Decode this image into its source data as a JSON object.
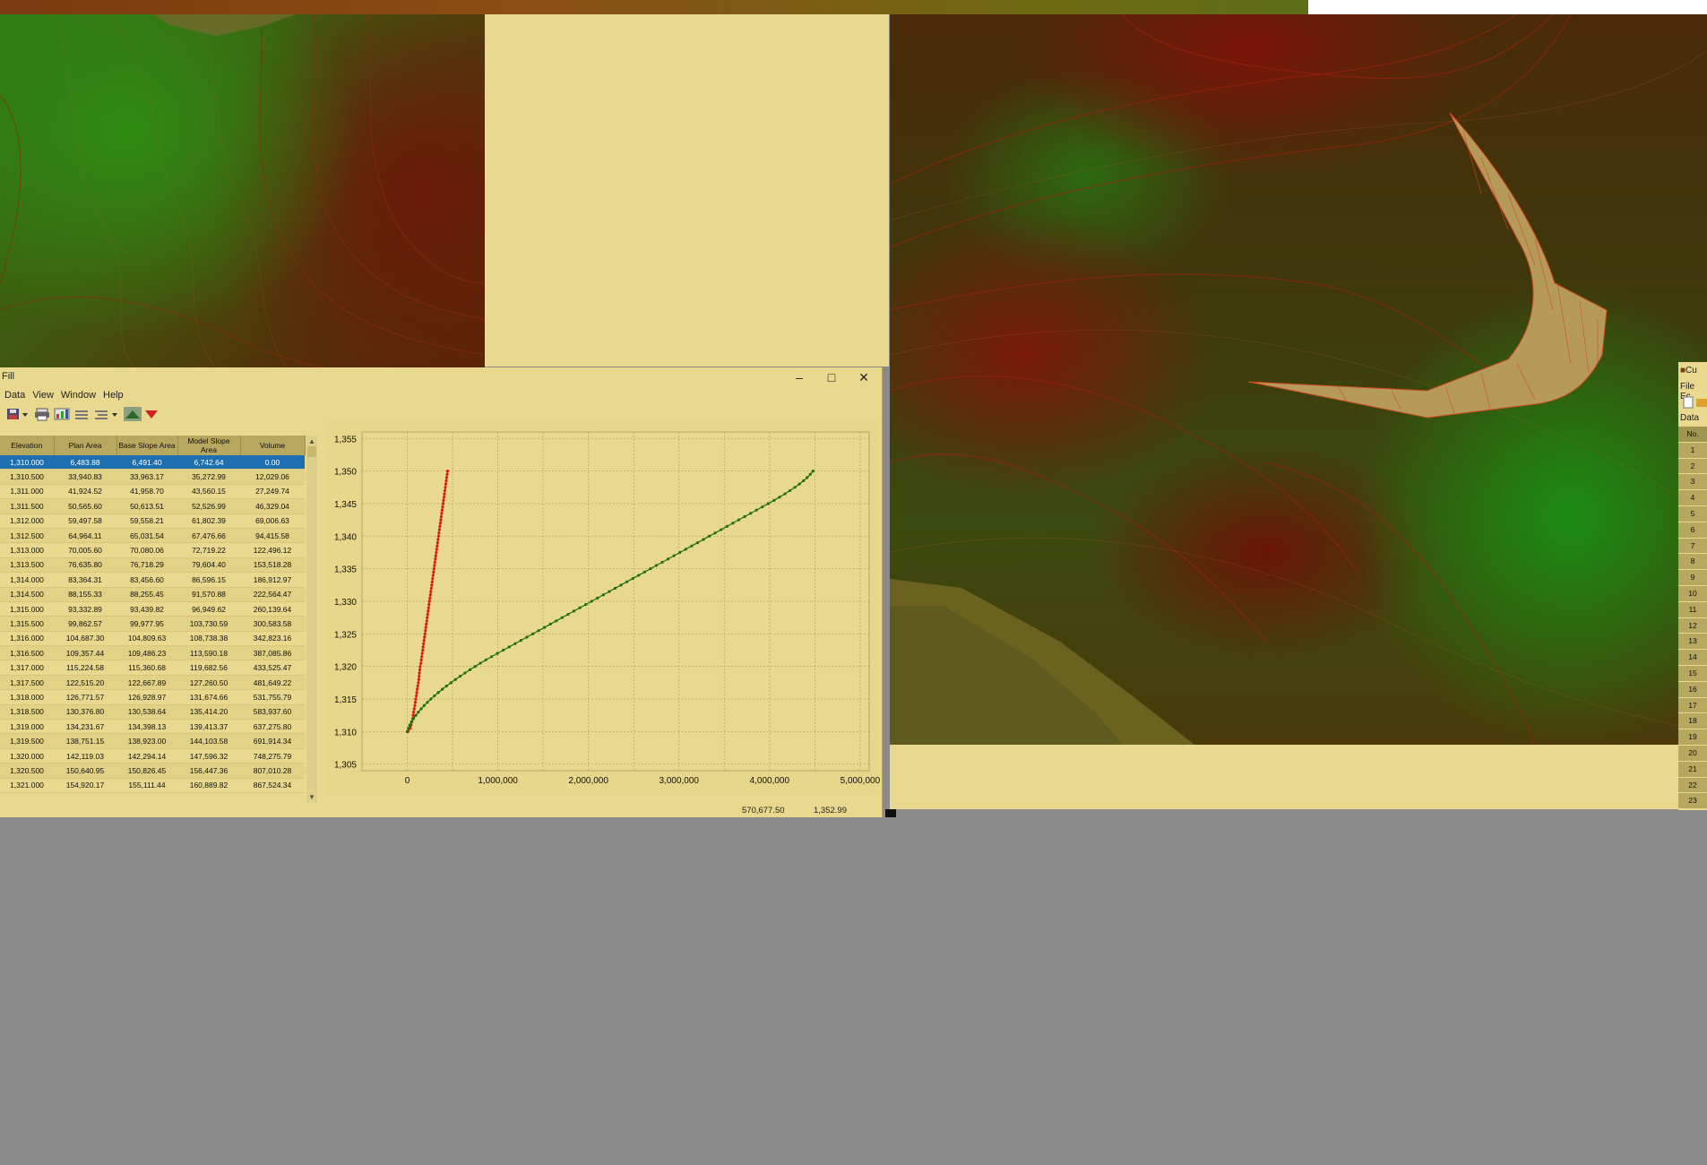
{
  "fill_window": {
    "title": "Fill",
    "menus": [
      "Data",
      "View",
      "Window",
      "Help"
    ],
    "window_buttons": {
      "minimize": "–",
      "maximize": "□",
      "close": "✕"
    },
    "table": {
      "columns": [
        "Elevation",
        "Plan Area",
        "Base Slope Area",
        "Model Slope Area",
        "Volume"
      ],
      "rows": [
        [
          "1,310.000",
          "6,483.88",
          "6,491.40",
          "6,742.64",
          "0.00"
        ],
        [
          "1,310.500",
          "33,940.83",
          "33,963.17",
          "35,272.99",
          "12,029.06"
        ],
        [
          "1,311.000",
          "41,924.52",
          "41,958.70",
          "43,560.15",
          "27,249.74"
        ],
        [
          "1,311.500",
          "50,565.60",
          "50,613.51",
          "52,526.99",
          "46,329.04"
        ],
        [
          "1,312.000",
          "59,497.58",
          "59,558.21",
          "61,802.39",
          "69,006.63"
        ],
        [
          "1,312.500",
          "64,964.11",
          "65,031.54",
          "67,476.66",
          "94,415.58"
        ],
        [
          "1,313.000",
          "70,005.60",
          "70,080.06",
          "72,719.22",
          "122,496.12"
        ],
        [
          "1,313.500",
          "76,635.80",
          "76,718.29",
          "79,604.40",
          "153,518.28"
        ],
        [
          "1,314.000",
          "83,364.31",
          "83,456.60",
          "86,596.15",
          "186,912.97"
        ],
        [
          "1,314.500",
          "88,155.33",
          "88,255.45",
          "91,570.88",
          "222,564.47"
        ],
        [
          "1,315.000",
          "93,332.89",
          "93,439.82",
          "96,949.62",
          "260,139.64"
        ],
        [
          "1,315.500",
          "99,862.57",
          "99,977.95",
          "103,730.59",
          "300,583.58"
        ],
        [
          "1,316.000",
          "104,687.30",
          "104,809.63",
          "108,738.38",
          "342,823.16"
        ],
        [
          "1,316.500",
          "109,357.44",
          "109,486.23",
          "113,590.18",
          "387,085.86"
        ],
        [
          "1,317.000",
          "115,224.58",
          "115,360.68",
          "119,682.56",
          "433,525.47"
        ],
        [
          "1,317.500",
          "122,515.20",
          "122,667.89",
          "127,260.50",
          "481,649.22"
        ],
        [
          "1,318.000",
          "126,771.57",
          "126,928.97",
          "131,674.66",
          "531,755.79"
        ],
        [
          "1,318.500",
          "130,376.80",
          "130,538.64",
          "135,414.20",
          "583,937.60"
        ],
        [
          "1,319.000",
          "134,231.67",
          "134,398.13",
          "139,413.37",
          "637,275.80"
        ],
        [
          "1,319.500",
          "138,751.15",
          "138,923.00",
          "144,103.58",
          "691,914.34"
        ],
        [
          "1,320.000",
          "142,119.03",
          "142,294.14",
          "147,596.32",
          "748,275.79"
        ],
        [
          "1,320.500",
          "150,640.95",
          "150,826.45",
          "156,447.36",
          "807,010.28"
        ],
        [
          "1,321.000",
          "154,920.17",
          "155,111.44",
          "160,889.82",
          "867,524.34"
        ]
      ]
    },
    "status": {
      "x_value": "570,677.50",
      "y_value": "1,352.99"
    }
  },
  "cu_window": {
    "title": "Cu",
    "menus": [
      "File",
      "Ec"
    ],
    "tab": "Data",
    "column": "No.",
    "rows": [
      "1",
      "2",
      "3",
      "4",
      "5",
      "6",
      "7",
      "8",
      "9",
      "10",
      "11",
      "12",
      "13",
      "14",
      "15",
      "16",
      "17",
      "18",
      "19",
      "20",
      "21",
      "22",
      "23"
    ]
  },
  "colors": {
    "panel": "#e8d98e",
    "header": "#b7a860",
    "selection": "#1e6fb0",
    "area_series": "#d81d0a",
    "volume_series": "#1e6e12"
  },
  "icons": [
    "save-icon",
    "print-icon",
    "chart-icon",
    "remove-row-icon",
    "insert-row-icon",
    "fill-icon",
    "cut-icon"
  ],
  "chart_data": {
    "type": "scatter",
    "x_ticks": [
      "0",
      "1,000,000",
      "2,000,000",
      "3,000,000",
      "4,000,000",
      "5,000,000"
    ],
    "y_ticks": [
      "1,305",
      "1,310",
      "1,315",
      "1,320",
      "1,325",
      "1,330",
      "1,335",
      "1,340",
      "1,345",
      "1,350",
      "1,355"
    ],
    "xlim": [
      -500000,
      5100000
    ],
    "ylim": [
      1304,
      1356
    ],
    "grid": true,
    "series": [
      {
        "color": "#d81d0a",
        "x": [
          6484,
          33941,
          41925,
          50566,
          59498,
          64964,
          70006,
          76636,
          83364,
          88155,
          93333,
          99863,
          104687,
          109357,
          115225,
          122515,
          126772,
          130377,
          134232,
          138751,
          142119,
          150641,
          154920,
          160000,
          165000,
          170000,
          175000,
          180000,
          185000,
          190000,
          195000,
          200000,
          205000,
          210000,
          215000,
          220000,
          225000,
          230000,
          235000,
          240000,
          245000,
          250000,
          255000,
          260000,
          265000,
          270000,
          275000,
          280000,
          285000,
          290000,
          295000,
          300000,
          305000,
          310000,
          315000,
          320000,
          325000,
          330000,
          335000,
          340000,
          345000,
          350000,
          355000,
          360000,
          365000,
          370000,
          375000,
          380000,
          385000,
          390000,
          395000,
          400000,
          405000,
          410000,
          415000,
          420000,
          425000,
          430000,
          435000,
          440000,
          445000
        ],
        "y": [
          1310,
          1310.5,
          1311,
          1311.5,
          1312,
          1312.5,
          1313,
          1313.5,
          1314,
          1314.5,
          1315,
          1315.5,
          1316,
          1316.5,
          1317,
          1317.5,
          1318,
          1318.5,
          1319,
          1319.5,
          1320,
          1320.5,
          1321,
          1321.5,
          1322,
          1322.5,
          1323,
          1323.5,
          1324,
          1324.5,
          1325,
          1325.5,
          1326,
          1326.5,
          1327,
          1327.5,
          1328,
          1328.5,
          1329,
          1329.5,
          1330,
          1330.5,
          1331,
          1331.5,
          1332,
          1332.5,
          1333,
          1333.5,
          1334,
          1334.5,
          1335,
          1335.5,
          1336,
          1336.5,
          1337,
          1337.5,
          1338,
          1338.5,
          1339,
          1339.5,
          1340,
          1340.5,
          1341,
          1341.5,
          1342,
          1342.5,
          1343,
          1343.5,
          1344,
          1344.5,
          1345,
          1345.5,
          1346,
          1346.5,
          1347,
          1347.5,
          1348,
          1348.5,
          1349,
          1349.5,
          1350
        ]
      },
      {
        "color": "#1e6e12",
        "x": [
          0,
          12029,
          27250,
          46329,
          69007,
          94416,
          122496,
          153518,
          186913,
          222564,
          260140,
          300584,
          342823,
          387086,
          433525,
          481649,
          531756,
          583938,
          637276,
          691914,
          748276,
          807010,
          867524,
          930000,
          995000,
          1060000,
          1125000,
          1190000,
          1255000,
          1320000,
          1385000,
          1450000,
          1515000,
          1580000,
          1645000,
          1710000,
          1775000,
          1840000,
          1905000,
          1970000,
          2035000,
          2100000,
          2165000,
          2230000,
          2295000,
          2360000,
          2425000,
          2490000,
          2555000,
          2620000,
          2685000,
          2750000,
          2815000,
          2880000,
          2945000,
          3010000,
          3075000,
          3140000,
          3205000,
          3270000,
          3335000,
          3400000,
          3465000,
          3530000,
          3595000,
          3660000,
          3725000,
          3790000,
          3855000,
          3920000,
          3985000,
          4050000,
          4110000,
          4170000,
          4225000,
          4280000,
          4330000,
          4375000,
          4415000,
          4450000,
          4480000
        ],
        "y": [
          1310,
          1310.5,
          1311,
          1311.5,
          1312,
          1312.5,
          1313,
          1313.5,
          1314,
          1314.5,
          1315,
          1315.5,
          1316,
          1316.5,
          1317,
          1317.5,
          1318,
          1318.5,
          1319,
          1319.5,
          1320,
          1320.5,
          1321,
          1321.5,
          1322,
          1322.5,
          1323,
          1323.5,
          1324,
          1324.5,
          1325,
          1325.5,
          1326,
          1326.5,
          1327,
          1327.5,
          1328,
          1328.5,
          1329,
          1329.5,
          1330,
          1330.5,
          1331,
          1331.5,
          1332,
          1332.5,
          1333,
          1333.5,
          1334,
          1334.5,
          1335,
          1335.5,
          1336,
          1336.5,
          1337,
          1337.5,
          1338,
          1338.5,
          1339,
          1339.5,
          1340,
          1340.5,
          1341,
          1341.5,
          1342,
          1342.5,
          1343,
          1343.5,
          1344,
          1344.5,
          1345,
          1345.5,
          1346,
          1346.5,
          1347,
          1347.5,
          1348,
          1348.5,
          1349,
          1349.5,
          1350
        ]
      }
    ]
  }
}
